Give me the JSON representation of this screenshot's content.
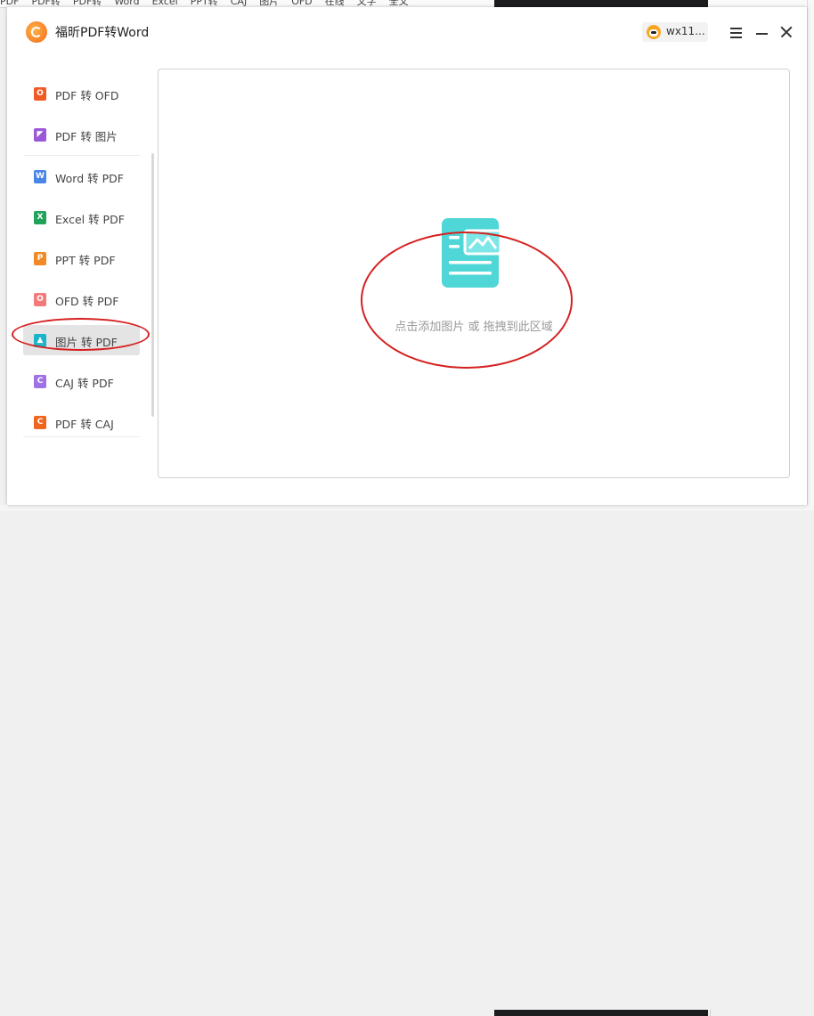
{
  "background": {
    "menu_items": [
      "PDF",
      "PDF转",
      "PDF转",
      "Word",
      "Excel",
      "PPT转",
      "CAJ",
      "图片",
      "OFD",
      "在线",
      "文字",
      "全文"
    ]
  },
  "app": {
    "title": "福昕PDF转Word",
    "user": "wx11...",
    "accent_color": "#f26a1b"
  },
  "sidebar": {
    "items": [
      {
        "label": "PDF 转 OFD",
        "icon": "ofd-icon",
        "color": "#f05a24",
        "glyph": "O"
      },
      {
        "label": "PDF 转 图片",
        "icon": "image-icon",
        "color": "#9b59d9",
        "glyph": "◤"
      },
      {
        "label": "Word 转 PDF",
        "icon": "word-icon",
        "color": "#4a86e8",
        "glyph": "W"
      },
      {
        "label": "Excel 转 PDF",
        "icon": "excel-icon",
        "color": "#21a35a",
        "glyph": "X"
      },
      {
        "label": "PPT 转 PDF",
        "icon": "ppt-icon",
        "color": "#f08a24",
        "glyph": "P"
      },
      {
        "label": "OFD 转 PDF",
        "icon": "ofd-pdf-icon",
        "color": "#f27a7a",
        "glyph": "O"
      },
      {
        "label": "图片 转 PDF",
        "icon": "picture-icon",
        "color": "#1ab5c8",
        "glyph": "▲"
      },
      {
        "label": "CAJ 转 PDF",
        "icon": "caj-icon",
        "color": "#a071e6",
        "glyph": "C"
      },
      {
        "label": "PDF 转 CAJ",
        "icon": "caj-export-icon",
        "color": "#f0661f",
        "glyph": "C"
      }
    ],
    "active_index": 6
  },
  "drop_zone": {
    "text": "点击添加图片 或 拖拽到此区域",
    "icon_color": "#4fd6d6"
  }
}
